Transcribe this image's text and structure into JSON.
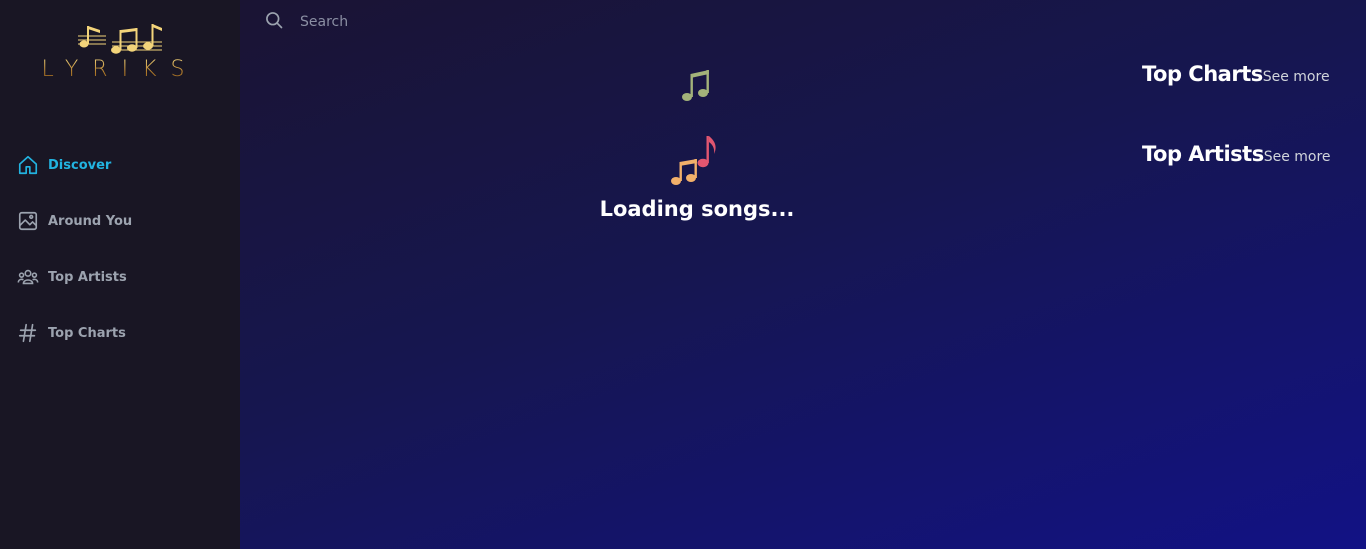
{
  "logo": {
    "text": "LYRIKS"
  },
  "sidebar": {
    "items": [
      {
        "label": "Discover",
        "icon": "home-icon",
        "active": true
      },
      {
        "label": "Around You",
        "icon": "image-icon",
        "active": false
      },
      {
        "label": "Top Artists",
        "icon": "users-icon",
        "active": false
      },
      {
        "label": "Top Charts",
        "icon": "hashtag-icon",
        "active": false
      }
    ]
  },
  "search": {
    "placeholder": "Search",
    "value": "",
    "icon": "search-icon"
  },
  "main": {
    "loading_text": "Loading songs...",
    "loader_icon": "music-notes-icon"
  },
  "top_charts": {
    "title": "Top Charts",
    "see_more": "See more"
  },
  "top_artists": {
    "title": "Top Artists",
    "see_more": "See more"
  },
  "colors": {
    "sidebar_bg": "#191624",
    "active_accent": "#22b3e0",
    "inactive_text": "#9ca3af",
    "logo_gold": "#b88a3a"
  }
}
